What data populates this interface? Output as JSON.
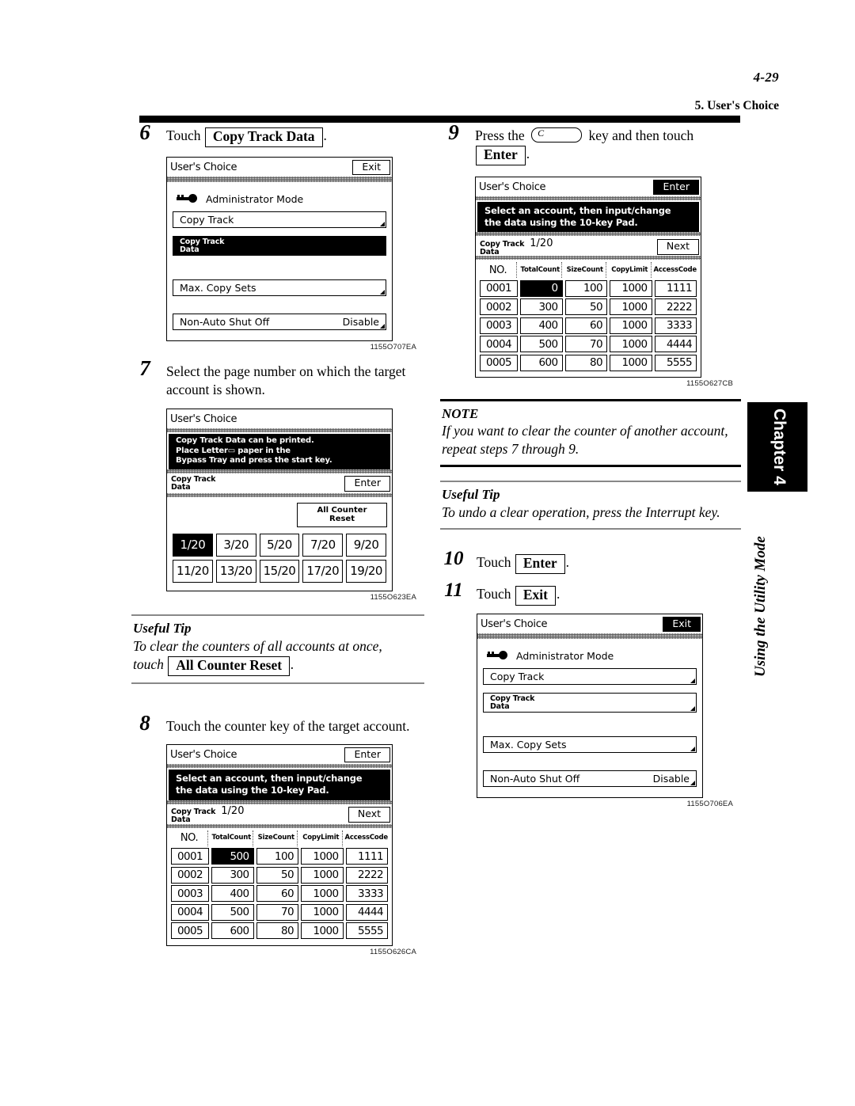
{
  "header": {
    "folio": "4-29",
    "running_head": "5. User's Choice"
  },
  "side_tab": {
    "chapter": "Chapter 4",
    "section_title": "Using the Utility Mode"
  },
  "steps": {
    "s6": {
      "num": "6",
      "text_before": "Touch",
      "button": "Copy Track Data",
      "text_after": "."
    },
    "s7": {
      "num": "7",
      "text": "Select the page number on which the target account is shown."
    },
    "s8": {
      "num": "8",
      "text": "Touch the counter key of the target account."
    },
    "s9": {
      "num": "9",
      "text_before": "Press the",
      "key_glyph": "C",
      "text_mid": "key and then touch",
      "button": "Enter",
      "text_after": "."
    },
    "s10": {
      "num": "10",
      "text_before": "Touch",
      "button": "Enter",
      "text_after": "."
    },
    "s11": {
      "num": "11",
      "text_before": "Touch",
      "button": "Exit",
      "text_after": "."
    }
  },
  "tips": {
    "left_tip": {
      "title": "Useful Tip",
      "line1": "To clear the counters of all accounts at once,",
      "line2_before": "touch",
      "button": "All Counter Reset",
      "line2_after": "."
    },
    "note": {
      "title": "NOTE",
      "text": "If you want to clear the counter of another account, repeat steps 7 through 9."
    },
    "right_tip": {
      "title": "Useful Tip",
      "text": "To undo a clear operation, press the Interrupt key."
    }
  },
  "figures": {
    "fig_admin_selected": {
      "code": "1155O707EA",
      "title": "User's Choice",
      "corner_button": "Exit",
      "corner_inverted": false,
      "mode_label": "Administrator Mode",
      "rows": [
        {
          "label": "Copy Track",
          "value": "",
          "inverted": false,
          "twoline": false
        },
        {
          "label_line1": "Copy Track",
          "label_line2": "Data",
          "value": "",
          "inverted": true,
          "twoline": true
        },
        {
          "label": "Max. Copy Sets",
          "value": "",
          "inverted": false,
          "twoline": false
        },
        {
          "label": "Non-Auto Shut Off",
          "value": "Disable",
          "inverted": false,
          "twoline": false
        }
      ]
    },
    "fig_page_select": {
      "code": "1155O623EA",
      "title": "User's Choice",
      "banner_line1": "Copy Track Data can be printed.",
      "banner_line2": "Place Letter▭ paper in the",
      "banner_line3": "Bypass Tray and press the start key.",
      "sub_label_line1": "Copy Track",
      "sub_label_line2": "Data",
      "sub_button": "Enter",
      "all_counter_reset_line1": "All Counter",
      "all_counter_reset_line2": "Reset",
      "pages_row1": [
        "1/20",
        "3/20",
        "5/20",
        "7/20",
        "9/20"
      ],
      "pages_row2": [
        "11/20",
        "13/20",
        "15/20",
        "17/20",
        "19/20"
      ],
      "selected_page": "1/20"
    },
    "fig_counter_500": {
      "code": "1155O626CA",
      "title": "User's Choice",
      "corner_button": "Enter",
      "corner_inverted": false,
      "banner_line1": "Select an account, then input/change",
      "banner_line2": "the data using the 10-key Pad.",
      "sub_label_line1": "Copy Track",
      "sub_label_line2": "Data",
      "page_indicator": "1/20",
      "sub_button": "Next",
      "columns": [
        "NO.",
        "Total\nCount",
        "Size\nCount",
        "Copy\nLimit",
        "Access\nCode"
      ],
      "col_headers": [
        {
          "l1": "NO.",
          "l2": ""
        },
        {
          "l1": "Total",
          "l2": "Count"
        },
        {
          "l1": "Size",
          "l2": "Count"
        },
        {
          "l1": "Copy",
          "l2": "Limit"
        },
        {
          "l1": "Access",
          "l2": "Code"
        }
      ],
      "rows": [
        {
          "no": "0001",
          "total": "500",
          "size": "100",
          "limit": "1000",
          "code": "1111",
          "total_selected": true
        },
        {
          "no": "0002",
          "total": "300",
          "size": "50",
          "limit": "1000",
          "code": "2222",
          "total_selected": false
        },
        {
          "no": "0003",
          "total": "400",
          "size": "60",
          "limit": "1000",
          "code": "3333",
          "total_selected": false
        },
        {
          "no": "0004",
          "total": "500",
          "size": "70",
          "limit": "1000",
          "code": "4444",
          "total_selected": false
        },
        {
          "no": "0005",
          "total": "600",
          "size": "80",
          "limit": "1000",
          "code": "5555",
          "total_selected": false
        }
      ]
    },
    "fig_counter_cleared": {
      "code": "1155O627CB",
      "title": "User's Choice",
      "corner_button": "Enter",
      "corner_inverted": true,
      "banner_line1": "Select an account, then input/change",
      "banner_line2": "the data using the 10-key Pad.",
      "sub_label_line1": "Copy Track",
      "sub_label_line2": "Data",
      "page_indicator": "1/20",
      "sub_button": "Next",
      "col_headers": [
        {
          "l1": "NO.",
          "l2": ""
        },
        {
          "l1": "Total",
          "l2": "Count"
        },
        {
          "l1": "Size",
          "l2": "Count"
        },
        {
          "l1": "Copy",
          "l2": "Limit"
        },
        {
          "l1": "Access",
          "l2": "Code"
        }
      ],
      "rows": [
        {
          "no": "0001",
          "total": "0",
          "size": "100",
          "limit": "1000",
          "code": "1111",
          "total_selected": true
        },
        {
          "no": "0002",
          "total": "300",
          "size": "50",
          "limit": "1000",
          "code": "2222",
          "total_selected": false
        },
        {
          "no": "0003",
          "total": "400",
          "size": "60",
          "limit": "1000",
          "code": "3333",
          "total_selected": false
        },
        {
          "no": "0004",
          "total": "500",
          "size": "70",
          "limit": "1000",
          "code": "4444",
          "total_selected": false
        },
        {
          "no": "0005",
          "total": "600",
          "size": "80",
          "limit": "1000",
          "code": "5555",
          "total_selected": false
        }
      ]
    },
    "fig_admin_exit": {
      "code": "1155O706EA",
      "title": "User's Choice",
      "corner_button": "Exit",
      "corner_inverted": true,
      "mode_label": "Administrator Mode",
      "rows": [
        {
          "label": "Copy Track",
          "value": "",
          "inverted": false,
          "twoline": false
        },
        {
          "label_line1": "Copy Track",
          "label_line2": "Data",
          "value": "",
          "inverted": false,
          "twoline": true
        },
        {
          "label": "Max. Copy Sets",
          "value": "",
          "inverted": false,
          "twoline": false
        },
        {
          "label": "Non-Auto Shut Off",
          "value": "Disable",
          "inverted": false,
          "twoline": false
        }
      ]
    }
  }
}
